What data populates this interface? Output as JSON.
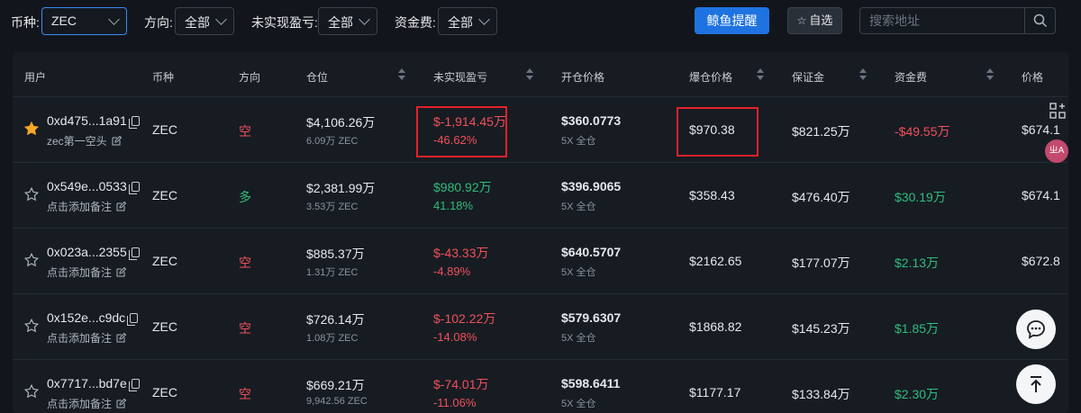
{
  "filters": {
    "coin_label": "币种:",
    "coin_value": "ZEC",
    "direction_label": "方向:",
    "direction_value": "全部",
    "pnl_label": "未实现盈亏:",
    "pnl_value": "全部",
    "funding_label": "资金费:",
    "funding_value": "全部",
    "alert_button": "鲸鱼提醒",
    "favorites_button": "自选",
    "search_placeholder": "搜索地址"
  },
  "columns": {
    "user": "用户",
    "coin": "币种",
    "direction": "方向",
    "position": "仓位",
    "unrealized_pnl": "未实现盈亏",
    "entry_price": "开仓价格",
    "liquidation_price": "爆仓价格",
    "margin": "保证金",
    "funding": "资金费",
    "price": "价格"
  },
  "rows": [
    {
      "starred": true,
      "address": "0xd475...1a91",
      "note": "zec第一空头",
      "coin": "ZEC",
      "direction": "空",
      "direction_type": "short",
      "position_value": "$4,106.26万",
      "position_size": "6.09万 ZEC",
      "pnl_value": "$-1,914.45万",
      "pnl_pct": "-46.62%",
      "pnl_type": "loss",
      "entry_price": "$360.0773",
      "leverage": "5X 全仓",
      "liq_price": "$970.38",
      "margin": "$821.25万",
      "funding": "-$49.55万",
      "funding_type": "neg",
      "price": "$674.1"
    },
    {
      "starred": false,
      "address": "0x549e...0533",
      "note": "点击添加备注",
      "coin": "ZEC",
      "direction": "多",
      "direction_type": "long",
      "position_value": "$2,381.99万",
      "position_size": "3.53万 ZEC",
      "pnl_value": "$980.92万",
      "pnl_pct": "41.18%",
      "pnl_type": "gain",
      "entry_price": "$396.9065",
      "leverage": "5X 全仓",
      "liq_price": "$358.43",
      "margin": "$476.40万",
      "funding": "$30.19万",
      "funding_type": "pos",
      "price": "$674.1"
    },
    {
      "starred": false,
      "address": "0x023a...2355",
      "note": "点击添加备注",
      "coin": "ZEC",
      "direction": "空",
      "direction_type": "short",
      "position_value": "$885.37万",
      "position_size": "1.31万 ZEC",
      "pnl_value": "$-43.33万",
      "pnl_pct": "-4.89%",
      "pnl_type": "loss",
      "entry_price": "$640.5707",
      "leverage": "5X 全仓",
      "liq_price": "$2162.65",
      "margin": "$177.07万",
      "funding": "$2.13万",
      "funding_type": "pos",
      "price": "$672.8"
    },
    {
      "starred": false,
      "address": "0x152e...c9dc",
      "note": "点击添加备注",
      "coin": "ZEC",
      "direction": "空",
      "direction_type": "short",
      "position_value": "$726.14万",
      "position_size": "1.08万 ZEC",
      "pnl_value": "$-102.22万",
      "pnl_pct": "-14.08%",
      "pnl_type": "loss",
      "entry_price": "$579.6307",
      "leverage": "5X 全仓",
      "liq_price": "$1868.82",
      "margin": "$145.23万",
      "funding": "$1.85万",
      "funding_type": "pos",
      "price": ""
    },
    {
      "starred": false,
      "address": "0x7717...bd7e",
      "note": "点击添加备注",
      "coin": "ZEC",
      "direction": "空",
      "direction_type": "short",
      "position_value": "$669.21万",
      "position_size": "9,942.56 ZEC",
      "pnl_value": "$-74.01万",
      "pnl_pct": "-11.06%",
      "pnl_type": "loss",
      "entry_price": "$598.6411",
      "leverage": "5X 全仓",
      "liq_price": "$1177.17",
      "margin": "$133.84万",
      "funding": "$2.30万",
      "funding_type": "pos",
      "price": ""
    }
  ],
  "floating": {
    "translate_label": "ㄓA"
  },
  "colors": {
    "accent": "#1f73e0",
    "loss": "#f0505a",
    "gain": "#2ebd7a",
    "highlight_box": "#e5202a",
    "star_active": "#f5a623"
  }
}
